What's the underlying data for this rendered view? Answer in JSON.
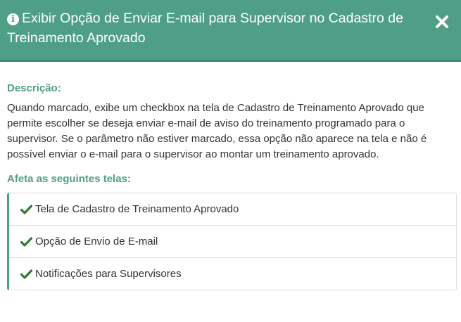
{
  "header": {
    "title": "Exibir Opção de Enviar E-mail para Supervisor no Cadastro de Treinamento Aprovado",
    "info_icon": "info-circle-icon",
    "close_icon": "close-icon"
  },
  "body": {
    "description_label": "Descrição:",
    "description_text": "Quando marcado, exibe um checkbox na tela de Cadastro de Treinamento Aprovado que permite escolher se deseja enviar e-mail de aviso do treinamento programado para o supervisor. Se o parâmetro não estiver marcado, essa opção não aparece na tela e não é possível enviar o e-mail para o supervisor ao montar um treinamento aprovado.",
    "affects_label": "Afeta as seguintes telas:",
    "screens": [
      {
        "label": "Tela de Cadastro de Treinamento Aprovado"
      },
      {
        "label": "Opção de Envio de E-mail"
      },
      {
        "label": "Notificações para Supervisores"
      }
    ]
  },
  "colors": {
    "accent": "#4f9f86",
    "check": "#2e7d32",
    "text": "#333333"
  }
}
